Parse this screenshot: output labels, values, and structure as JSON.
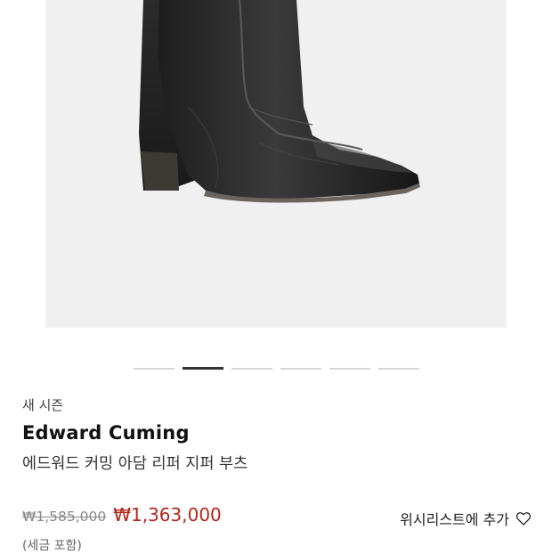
{
  "product": {
    "image_alt": "product-boot-image",
    "carousel": {
      "total": 6,
      "active": 1
    },
    "season_label": "새 시즌",
    "brand": "Edward Cuming",
    "name": "에드워드 커밍 아담 리퍼 지퍼 부츠",
    "original_price": "₩1,585,000",
    "sale_price": "₩1,363,000",
    "tax_note": "(세금 포함)",
    "wishlist_label": "위시리스트에 추가"
  },
  "colors": {
    "sale": "#b3261e",
    "image_background": "#f0f0f0"
  },
  "icons": {
    "wishlist": "heart-outline-icon"
  }
}
